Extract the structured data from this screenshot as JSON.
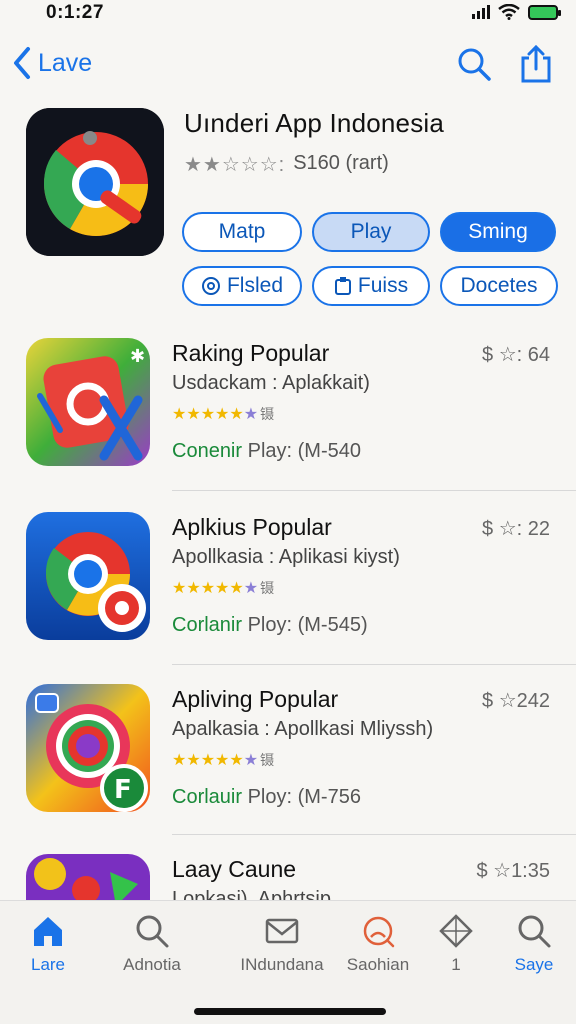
{
  "status": {
    "time": "0:1:27"
  },
  "nav": {
    "back_label": "Lave"
  },
  "app": {
    "title": "Uınderi App Indonesia",
    "stars": "★★☆☆☆:",
    "rating_text": "S160 (rart)",
    "pills_row1": [
      "Matp",
      "Play",
      "Sming"
    ],
    "pills_row2": [
      "Flsled",
      "Fuiss",
      "Docetes"
    ]
  },
  "items": [
    {
      "title": "Raking Popular",
      "price": "$ ☆: 64",
      "sub": "Usdackam : Aplaƙkait)",
      "stars": "★★★★★",
      "half": "★",
      "tag": "镊",
      "meta_green": "Conenir",
      "meta_rest": "Play: (M-540"
    },
    {
      "title": "Aplkius Popular",
      "price": "$ ☆: 22",
      "sub": "Apollkasia : Aplikasi kiyst)",
      "stars": "★★★★★",
      "half": "★",
      "tag": "镊",
      "meta_green": "Corlanir",
      "meta_rest": "Ploy: (M-545)"
    },
    {
      "title": "Apliving Popular",
      "price": "$ ☆242",
      "sub": "Apalkasia : Apollkasi Mliyssh)",
      "stars": "★★★★★",
      "half": "★",
      "tag": "镊",
      "meta_green": "Corlauir",
      "meta_rest": "Ploy: (M-756"
    },
    {
      "title": "Laay Caune",
      "price": "$ ☆1:35",
      "sub": "Lopkasi). Aphrtsip",
      "stars": "",
      "half": "",
      "tag": "",
      "meta_green": "",
      "meta_rest": ""
    }
  ],
  "tabs": [
    {
      "label": "Lare",
      "icon": "home-icon"
    },
    {
      "label": "Adnotia",
      "icon": "search-icon"
    },
    {
      "label": "INdundana",
      "icon": "mail-icon"
    },
    {
      "label": "Saohian",
      "icon": "face-icon"
    },
    {
      "label": "1",
      "icon": "diamond-icon"
    },
    {
      "label": "Saye",
      "icon": "search-icon"
    }
  ],
  "colors": {
    "accent": "#1a73e8",
    "green": "#1a8a3a",
    "star": "#f1b800"
  }
}
